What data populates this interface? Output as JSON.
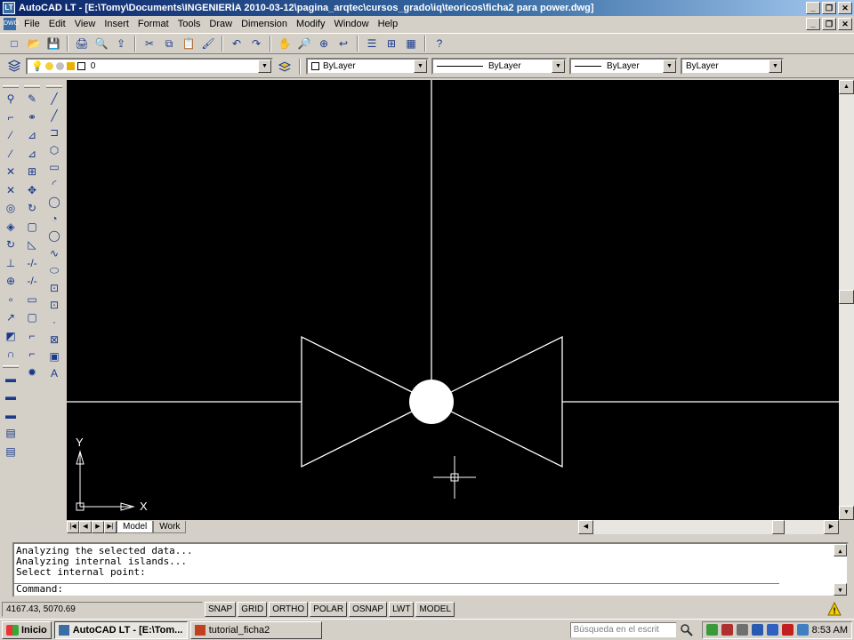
{
  "window": {
    "title": "AutoCAD LT - [E:\\Tomy\\Documents\\INGENIERÍA 2010-03-12\\pagina_arqtec\\cursos_grado\\iq\\teoricos\\ficha2 para power.dwg]",
    "app_badge": "LT",
    "minimize_glyph": "_",
    "restore_glyph": "❐",
    "close_glyph": "✕"
  },
  "menu": {
    "doc_badge": "DWG",
    "items": [
      "File",
      "Edit",
      "View",
      "Insert",
      "Format",
      "Tools",
      "Draw",
      "Dimension",
      "Modify",
      "Window",
      "Help"
    ]
  },
  "standard_toolbar": {
    "icons": [
      "new-icon",
      "open-icon",
      "save-icon",
      "plot-icon",
      "plot-preview-icon",
      "publish-icon",
      "cut-icon",
      "copy-icon",
      "paste-icon",
      "match-properties-icon",
      "undo-icon",
      "redo-icon",
      "pan-icon",
      "zoom-realtime-icon",
      "zoom-window-icon",
      "zoom-previous-icon",
      "properties-icon",
      "design-center-icon",
      "tool-palettes-icon",
      "help-icon"
    ],
    "glyphs": [
      "□",
      "📂",
      "💾",
      "🖨",
      "🔍",
      "⇪",
      "✂",
      "⧉",
      "📋",
      "🖌",
      "↶",
      "↷",
      "✋",
      "🔎",
      "⊕",
      "↩",
      "☰",
      "⊞",
      "▦",
      "?"
    ]
  },
  "layers_toolbar": {
    "layer_value": "0",
    "color_value": "ByLayer",
    "linetype_value": "ByLayer",
    "lineweight_value": "ByLayer",
    "plotstyle_value": "ByLayer",
    "dropdown_glyph": "▼"
  },
  "left_toolbars": {
    "col1": [
      "⚲",
      "⌐",
      "⁄",
      "⁄",
      "✕",
      "✕",
      "◎",
      "◈",
      "↻",
      "⊥",
      "⊕",
      "∘",
      "↗",
      "◩",
      "∩"
    ],
    "col2": [
      "✎",
      "⚭",
      "⊿",
      "⊿",
      "⊞",
      "✥",
      "↻",
      "▢",
      "◺",
      "-/-",
      "-/-",
      "▭",
      "▢",
      "⌐",
      "⌐",
      "✹"
    ],
    "col1b": [
      "▬",
      "▬",
      "▬",
      "▤",
      "▤"
    ]
  },
  "draw_toolbar": {
    "glyphs": [
      "╱",
      "╱",
      "⊐",
      "⬡",
      "▭",
      "◜",
      "◯",
      "◔",
      "◯",
      "∿",
      "⬭",
      "⊡",
      "⊡",
      "·",
      "⊠",
      "▣",
      "A"
    ]
  },
  "drawing": {
    "ucs_x_label": "X",
    "ucs_y_label": "Y"
  },
  "scrollbar": {
    "up_glyph": "▲",
    "down_glyph": "▼",
    "left_glyph": "◀",
    "right_glyph": "▶"
  },
  "layout_tabs": {
    "nav": [
      "|◀",
      "◀",
      "▶",
      "▶|"
    ],
    "tabs": [
      "Model",
      "Work"
    ]
  },
  "command_window": {
    "lines": [
      "Analyzing the selected data...",
      "Analyzing internal islands...",
      "Select internal point:"
    ],
    "prompt": "Command:"
  },
  "status_bar": {
    "coordinates": "4167.43, 5070.69",
    "toggles": [
      "SNAP",
      "GRID",
      "ORTHO",
      "POLAR",
      "OSNAP",
      "LWT",
      "MODEL"
    ]
  },
  "taskbar": {
    "start_label": "Inicio",
    "tasks": [
      {
        "label": "AutoCAD LT - [E:\\Tom...",
        "active": true
      },
      {
        "label": "tutorial_ficha2",
        "active": false
      }
    ],
    "search_placeholder": "Búsqueda en el escrit",
    "clock": "8:53 AM"
  },
  "colors": {
    "titlebar_start": "#0a246a",
    "canvas_bg": "#000000",
    "drawing_lines": "#ffffff",
    "chrome": "#d4d0c8"
  }
}
